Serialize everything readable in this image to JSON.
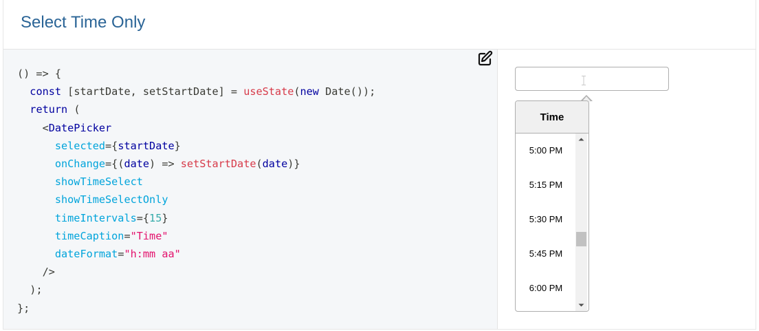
{
  "header": {
    "title": "Select Time Only"
  },
  "editor": {
    "edit_icon": "edit-icon",
    "lines": {
      "l1": "() => {",
      "l2_a": "const ",
      "l2_b": "[startDate, setStartDate] = ",
      "l2_c": "useState",
      "l2_d": "(",
      "l2_e": "new ",
      "l2_f": "Date",
      "l2_g": "());",
      "l3_a": "return ",
      "l3_b": "(",
      "l4_a": "<",
      "l4_b": "DatePicker",
      "l5_a": "selected",
      "l5_b": "={",
      "l5_c": "startDate",
      "l5_d": "}",
      "l6_a": "onChange",
      "l6_b": "={(",
      "l6_c": "date",
      "l6_d": ") => ",
      "l6_e": "setStartDate",
      "l6_f": "(",
      "l6_g": "date",
      "l6_h": ")}",
      "l7": "showTimeSelect",
      "l8": "showTimeSelectOnly",
      "l9_a": "timeIntervals",
      "l9_b": "={",
      "l9_c": "15",
      "l9_d": "}",
      "l10_a": "timeCaption",
      "l10_b": "=",
      "l10_c": "\"Time\"",
      "l11_a": "dateFormat",
      "l11_b": "=",
      "l11_c": "\"h:mm aa\"",
      "l12": "/>",
      "l13": ");",
      "l14": "};"
    }
  },
  "time_input": {
    "value": "",
    "placeholder": ""
  },
  "picker": {
    "header": "Time",
    "times": [
      "5:00 PM",
      "5:15 PM",
      "5:30 PM",
      "5:45 PM",
      "6:00 PM"
    ],
    "scroll_position": 0.62
  },
  "icons": {
    "scroll_up": "triangle-up-icon",
    "scroll_down": "triangle-down-icon",
    "text_cursor": "i-beam-cursor-icon"
  }
}
